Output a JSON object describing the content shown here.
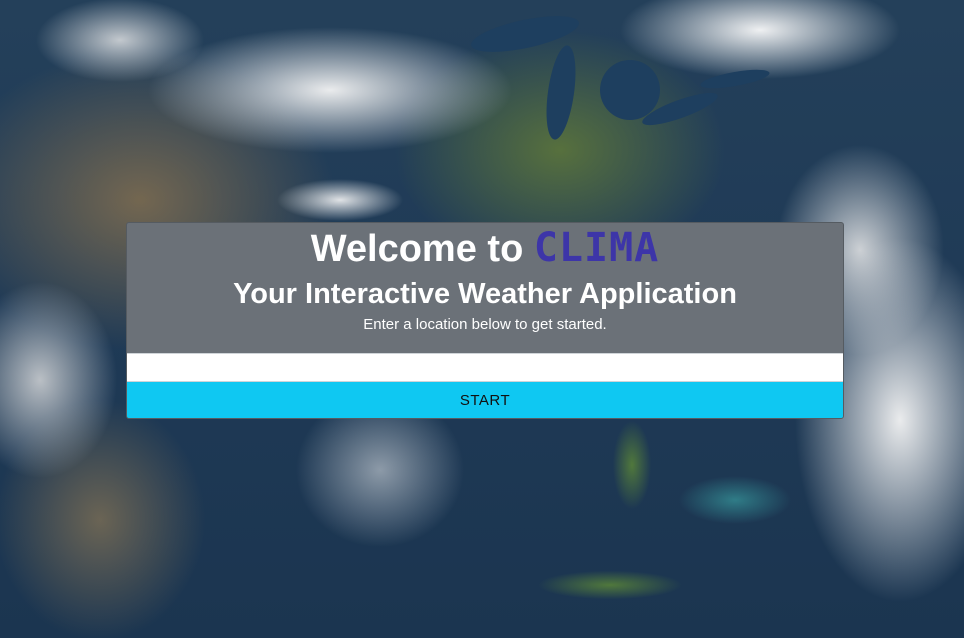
{
  "hero": {
    "welcome_prefix": "Welcome to ",
    "brand_name": "CLIMA",
    "subtitle": "Your Interactive Weather Application",
    "hint": "Enter a location below to get started."
  },
  "search": {
    "value": "",
    "placeholder": ""
  },
  "actions": {
    "start_label": "START"
  },
  "colors": {
    "brand": "#3d35a8",
    "card_background": "#6b7178",
    "start_button": "#0fc8f2"
  },
  "background": {
    "icon": "satellite-earth-imagery"
  }
}
